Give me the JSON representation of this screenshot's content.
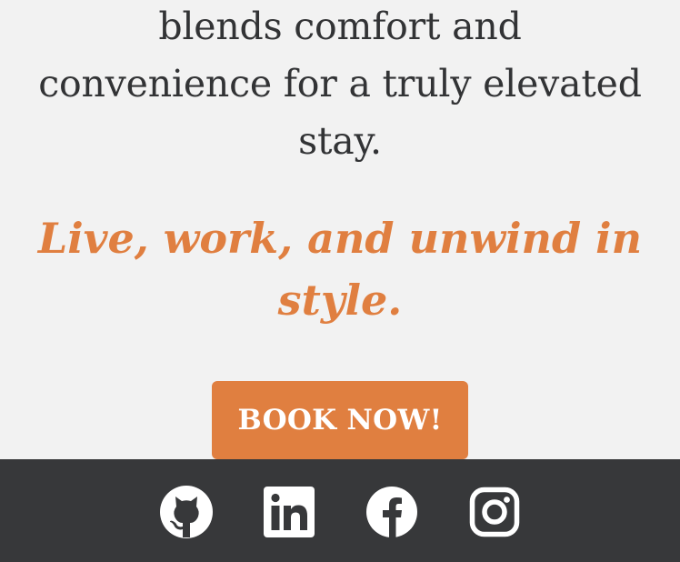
{
  "intro": {
    "lines": [
      "blends comfort and",
      "convenience for a truly elevated",
      "stay."
    ]
  },
  "tagline": {
    "lines": [
      "Live, work, and unwind in",
      "style."
    ],
    "color": "#e07f40"
  },
  "cta": {
    "label": "BOOK NOW!",
    "color": "#e07f40"
  },
  "footer": {
    "background": "#37383a",
    "social_icons": [
      "github-icon",
      "linkedin-icon",
      "facebook-icon",
      "instagram-icon"
    ]
  }
}
